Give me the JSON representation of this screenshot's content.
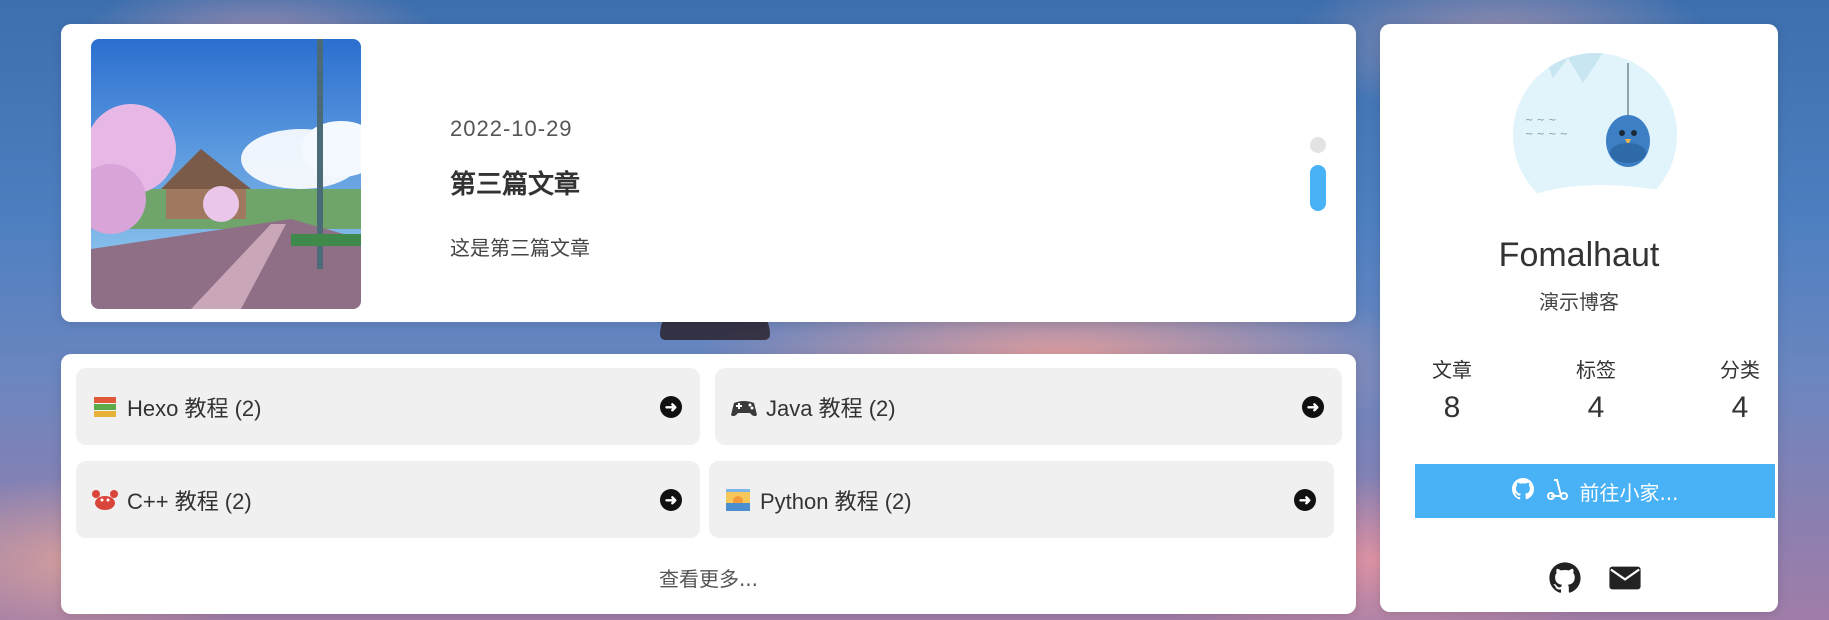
{
  "featured_post": {
    "date": "2022-10-29",
    "title": "第三篇文章",
    "excerpt": "这是第三篇文章"
  },
  "categories": [
    {
      "name": "Hexo 教程 (2)",
      "emoji": "books-icon"
    },
    {
      "name": "Java 教程 (2)",
      "emoji": "gamepad-icon"
    },
    {
      "name": "C++ 教程 (2)",
      "emoji": "crab-icon"
    },
    {
      "name": "Python 教程 (2)",
      "emoji": "sunset-icon"
    }
  ],
  "categories_more": "查看更多...",
  "author": {
    "name": "Fomalhaut",
    "description": "演示博客",
    "stats": [
      {
        "label": "文章",
        "value": "8"
      },
      {
        "label": "标签",
        "value": "4"
      },
      {
        "label": "分类",
        "value": "4"
      }
    ],
    "button_label": "前往小家..."
  },
  "colors": {
    "accent": "#49b1f5",
    "card": "#ffffff",
    "category_bg": "#f0f0f0"
  }
}
